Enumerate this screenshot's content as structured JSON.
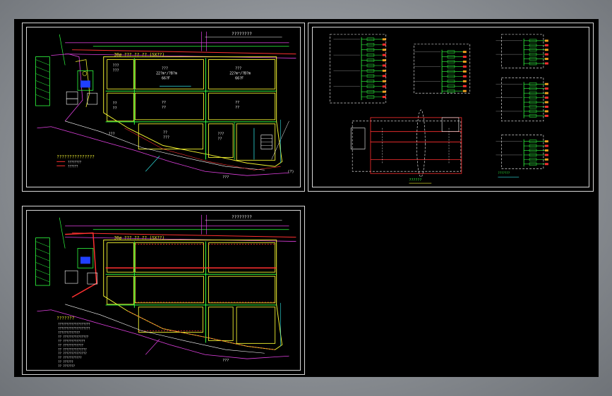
{
  "colors": {
    "background": "#000000",
    "frame": "#d8d8d8",
    "road": "#e040e0",
    "building": "#f0f030",
    "green": "#30ff40",
    "cyan": "#30e0e0",
    "red": "#ff3030",
    "blue": "#4060ff",
    "white": "#ffffff"
  },
  "sheet1": {
    "top_label": "30ø ??? ?? ?? (SX??)",
    "top_right_label": "????????",
    "blocks": {
      "b1_line1": "???",
      "b1_line2": "???",
      "b2_line1": "??",
      "b2_line2": "??",
      "b3_line1": "???",
      "b3_line2": "22?m²/?B?m",
      "b3_line3": "66?F",
      "b4_line1": "???",
      "b4_line2": "22?m²/?B?m",
      "b4_line3": "66?F",
      "b5_line1": "??",
      "b5_line2": "??",
      "b6_line1": "??",
      "b6_line2": "??",
      "b7_line1": "??",
      "b7_line2": "???",
      "b8_line1": "???",
      "b8_line2": "??"
    },
    "road_label": "???",
    "road_label2": "???",
    "compass": "(?)",
    "legend_title": "???????????????",
    "legend_items": [
      "????????",
      "??????"
    ]
  },
  "sheet2": {
    "title": "??????",
    "note": "???????"
  },
  "sheet3": {
    "top_label": "30ø ??? ?? ?? (SX??)",
    "top_right_label": "????????",
    "road_label": "???",
    "legend_title": "???????",
    "legend_items": [
      "???????????????????",
      "???????????????????",
      "?????????????",
      "?? ???????????????",
      "?? ?????????????",
      "?? ????????????",
      "?? ??????????????",
      "?? ??????????????",
      "?? ???????????",
      "?? ??????",
      "?? ???????"
    ]
  }
}
